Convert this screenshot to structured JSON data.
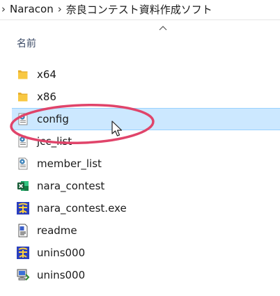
{
  "breadcrumb": {
    "segments": [
      "Naracon",
      "奈良コンテスト資料作成ソフト"
    ]
  },
  "list_header": {
    "name_column": "名前",
    "sort_direction": "ascending"
  },
  "files": [
    {
      "name": "x64",
      "icon": "folder-icon",
      "selected": false
    },
    {
      "name": "x86",
      "icon": "folder-icon",
      "selected": false
    },
    {
      "name": "config",
      "icon": "config-settings-file-icon",
      "selected": true
    },
    {
      "name": "jcc_list",
      "icon": "config-settings-file-icon",
      "selected": false
    },
    {
      "name": "member_list",
      "icon": "config-settings-file-icon",
      "selected": false
    },
    {
      "name": "nara_contest",
      "icon": "excel-icon",
      "selected": false
    },
    {
      "name": "nara_contest.exe",
      "icon": "app-icon",
      "selected": false
    },
    {
      "name": "readme",
      "icon": "text-document-icon",
      "selected": false
    },
    {
      "name": "unins000",
      "icon": "app-icon",
      "selected": false
    },
    {
      "name": "unins000",
      "icon": "uninstaller-icon",
      "selected": false
    }
  ],
  "colors": {
    "selection_bg": "#cce8ff",
    "selection_border": "#99d1ff",
    "annotation": "#e0446a",
    "folder": "#f8c842"
  }
}
